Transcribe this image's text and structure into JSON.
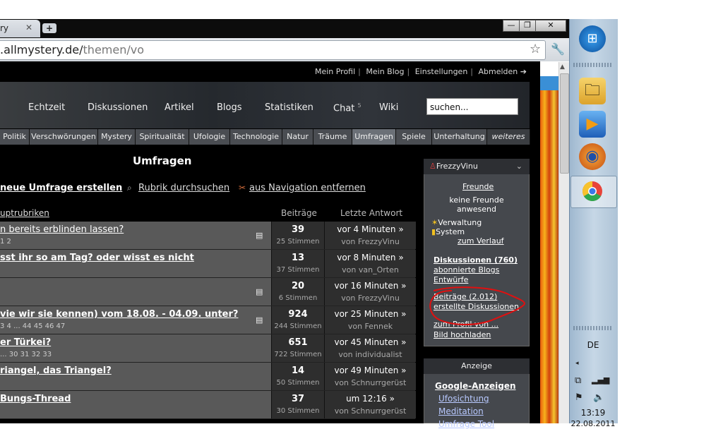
{
  "browser": {
    "tab_title": "ry",
    "tab_close": "✕",
    "new_tab": "+",
    "win_minimize": "—",
    "win_restore": "❐",
    "win_close": "✕",
    "url_host": ".allmystery.de/",
    "url_path": "themen/vo"
  },
  "site": {
    "toplinks": [
      "Mein Profil",
      "Mein Blog",
      "Einstellungen",
      "Abmelden ➔"
    ],
    "nav": [
      "Echtzeit",
      "Diskussionen",
      "Artikel",
      "Blogs",
      "Statistiken",
      "Chat",
      "Wiki"
    ],
    "chat_count": "5",
    "search_placeholder": "suchen...",
    "categories": [
      "Politik",
      "Verschwörungen",
      "Mystery",
      "Spiritualität",
      "Ufologie",
      "Technologie",
      "Natur",
      "Träume",
      "Umfragen",
      "Spiele",
      "Unterhaltung",
      "weiteres"
    ]
  },
  "main": {
    "heading": "Umfragen",
    "action_new": "neue Umfrage erstellen",
    "action_search": "Rubrik durchsuchen",
    "action_remove": "aus Navigation entfernen",
    "col_topic": "uptrubriken",
    "col_posts": "Beiträge",
    "col_last": "Letzte Antwort",
    "rows": [
      {
        "title": "n bereits erblinden lassen?",
        "pages": "1 2",
        "count": "39",
        "votes": "25 Stimmen",
        "when": "vor 4 Minuten »",
        "by": "von FrezzyVinu"
      },
      {
        "title": "sst ihr so am Tag? oder wisst es nicht",
        "pages": "",
        "count": "13",
        "votes": "37 Stimmen",
        "when": "vor 8 Minuten »",
        "by": "von van_Orten"
      },
      {
        "title": "",
        "pages": "",
        "count": "20",
        "votes": "6 Stimmen",
        "when": "vor 16 Minuten »",
        "by": "von FrezzyVinu"
      },
      {
        "title": "vie wir sie kennen) vom 18.08. - 04.09. unter?",
        "pages": "3 4 ... 44 45 46 47",
        "count": "924",
        "votes": "244 Stimmen",
        "when": "vor 25 Minuten »",
        "by": "von Fennek"
      },
      {
        "title": "er Türkei?",
        "pages": "... 30 31 32 33",
        "count": "651",
        "votes": "722 Stimmen",
        "when": "vor 45 Minuten »",
        "by": "von individualist"
      },
      {
        "title": "riangel, das Triangel?",
        "pages": "",
        "count": "14",
        "votes": "50 Stimmen",
        "when": "vor 49 Minuten »",
        "by": "von Schnurrgerüst"
      },
      {
        "title": "Bungs-Thread",
        "pages": "",
        "count": "37",
        "votes": "30 Stimmen",
        "when": "um 12:16 »",
        "by": "von Schnurrgerüst"
      }
    ]
  },
  "panel": {
    "user": "FrezzyVinu",
    "friends": "Freunde",
    "friends_none_1": "keine Freunde",
    "friends_none_2": "anwesend",
    "admin": "Verwaltung",
    "system": "System",
    "history": "zum Verlauf",
    "discussions": "Diskussionen (760)",
    "subscribed": "abonnierte Blogs",
    "drafts": "Entwürfe",
    "posts": "Beiträge (2.012)",
    "created": "erstellte Diskussionen",
    "profile": "zum Profil von ...",
    "upload": "Bild hochladen"
  },
  "ads": {
    "title": "Anzeige",
    "google": "Google-Anzeigen",
    "links": [
      "Ufosichtung",
      "Meditation",
      "Umfrage Tool"
    ]
  },
  "taskbar": {
    "lang": "DE",
    "time": "13:19",
    "date": "22.08.2011"
  },
  "colors": {
    "annotation": "#e01010",
    "page_bg": "#000000",
    "row_bg": "#595959"
  }
}
